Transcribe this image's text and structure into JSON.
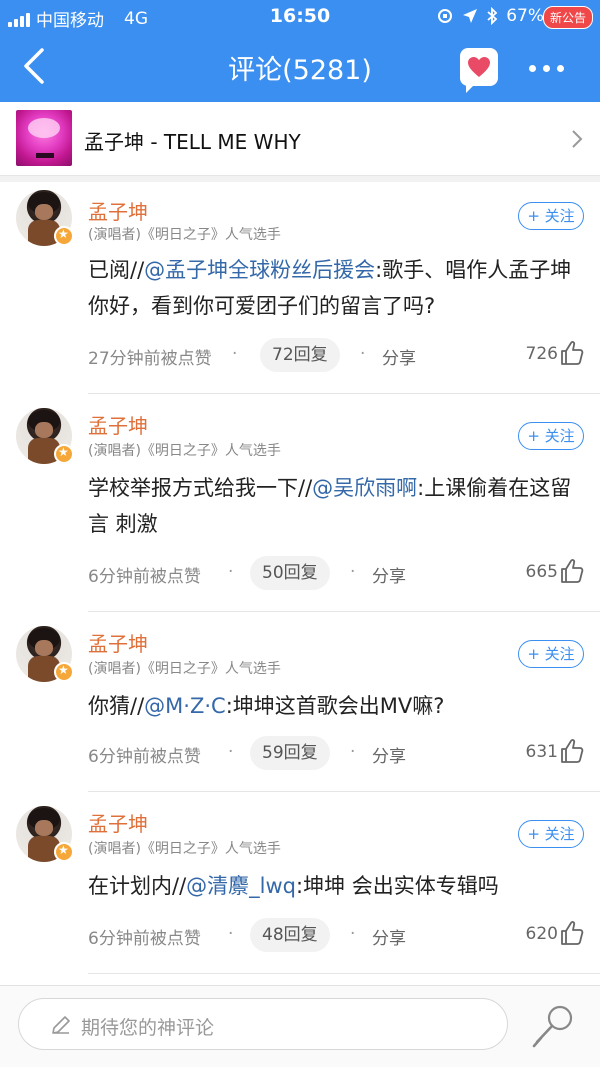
{
  "status": {
    "carrier": "中国移动",
    "network": "4G",
    "time": "16:50",
    "battery": "67%"
  },
  "header": {
    "title": "评论(5281)",
    "badge": "新公告"
  },
  "song": {
    "title": "孟子坤 - TELL ME WHY"
  },
  "comments": [
    {
      "name": "孟子坤",
      "role": "(演唱者)《明日之子》人气选手",
      "follow": "+ 关注",
      "prefix": "已阅//",
      "mention": "@孟子坤全球粉丝后援会",
      "text": ":歌手、唱作人孟子坤你好，看到你可爱团子们的留言了吗?",
      "time": "27分钟前被点赞",
      "replies": "72回复",
      "share": "分享",
      "likes": "726"
    },
    {
      "name": "孟子坤",
      "role": "(演唱者)《明日之子》人气选手",
      "follow": "+ 关注",
      "prefix": "学校举报方式给我一下//",
      "mention": "@吴欣雨啊",
      "text": ":上课偷着在这留言 刺激",
      "time": "6分钟前被点赞",
      "replies": "50回复",
      "share": "分享",
      "likes": "665"
    },
    {
      "name": "孟子坤",
      "role": "(演唱者)《明日之子》人气选手",
      "follow": "+ 关注",
      "prefix": "你猜//",
      "mention": "@M·Z·C",
      "text": ":坤坤这首歌会出MV嘛?",
      "time": "6分钟前被点赞",
      "replies": "59回复",
      "share": "分享",
      "likes": "631"
    },
    {
      "name": "孟子坤",
      "role": "(演唱者)《明日之子》人气选手",
      "follow": "+ 关注",
      "prefix": "在计划内//",
      "mention": "@清麖_lwq",
      "text": ":坤坤 会出实体专辑吗",
      "time": "6分钟前被点赞",
      "replies": "48回复",
      "share": "分享",
      "likes": "620"
    }
  ],
  "input": {
    "placeholder": "期待您的神评论"
  },
  "colors": {
    "header_blue": "#3b8ff0",
    "name_orange": "#e0703a",
    "mention_blue": "#3468a9",
    "badge_red": "#f04848"
  }
}
